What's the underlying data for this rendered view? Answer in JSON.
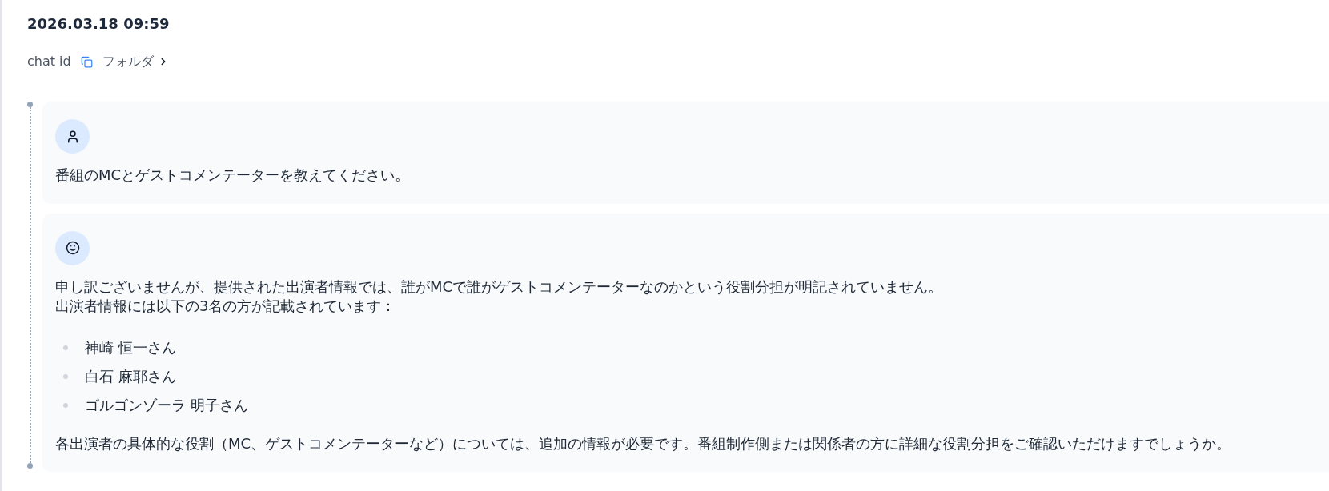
{
  "header": {
    "title": "2026.03.18 09:59",
    "chat_id_label": "chat id",
    "folder_link": "フォルダ"
  },
  "messages": [
    {
      "kind": "user",
      "blocks": [
        {
          "kind": "paragraph",
          "lines": [
            "番組のMCとゲストコメンテーターを教えてください。"
          ]
        }
      ]
    },
    {
      "kind": "assistant",
      "blocks": [
        {
          "kind": "paragraph",
          "lines": [
            "申し訳ございませんが、提供された出演者情報では、誰がMCで誰がゲストコメンテーターなのかという役割分担が明記されていません。",
            "出演者情報には以下の3名の方が記載されています："
          ]
        },
        {
          "kind": "list",
          "items": [
            "神崎 恒一さん",
            "白石 麻耶さん",
            "ゴルゴンゾーラ 明子さん"
          ]
        },
        {
          "kind": "paragraph",
          "lines": [
            "各出演者の具体的な役割（MC、ゲストコメンテーターなど）については、追加の情報が必要です。番組制作側または関係者の方に詳細な役割分担をご確認いただけますでしょうか。"
          ]
        }
      ]
    }
  ]
}
